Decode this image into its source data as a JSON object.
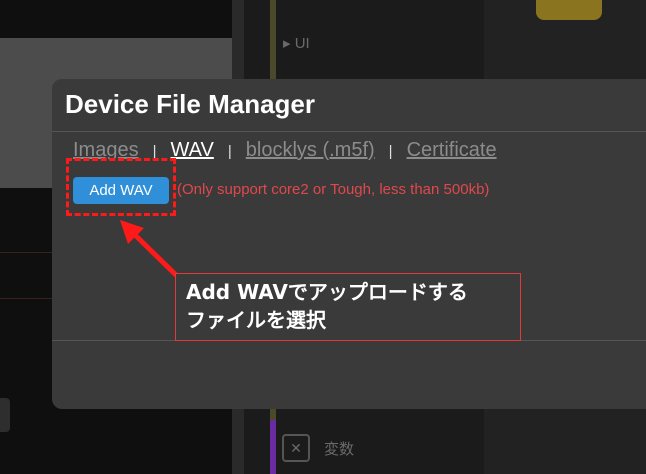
{
  "background": {
    "ui_label": "UI",
    "ui_caret": "▸",
    "variables_label": "変数",
    "variables_icon": "x-variable-icon"
  },
  "modal": {
    "title": "Device File Manager",
    "tabs": [
      {
        "label": "Images",
        "active": false
      },
      {
        "label": "WAV",
        "active": true
      },
      {
        "label": "blocklys (.m5f)",
        "active": false
      },
      {
        "label": "Certificate",
        "active": false
      }
    ],
    "separator": "|",
    "add_button_label": "Add WAV",
    "hint_text": "(Only support core2 or Tough, less than 500kb)"
  },
  "annotation": {
    "callout_text": "Add WAVでアップロードする\nファイルを選択",
    "color": "#ff1a1a"
  },
  "colors": {
    "modal_bg": "#3a3a3a",
    "button_blue": "#2f8fd8",
    "hint_red": "#e0484d"
  }
}
